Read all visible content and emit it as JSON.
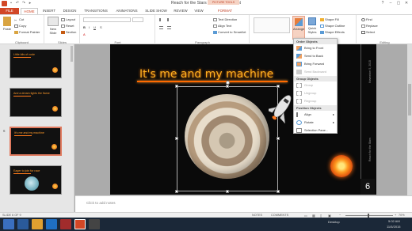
{
  "window": {
    "title": "Reach for the Stars EAN - PowerPoint",
    "contextual_tools": "PICTURE TOOLS",
    "user": "Elizabeth Nofs",
    "buttons": [
      "?",
      "–",
      "▢",
      "✕"
    ]
  },
  "tabs": [
    "FILE",
    "HOME",
    "INSERT",
    "DESIGN",
    "TRANSITIONS",
    "ANIMATIONS",
    "SLIDE SHOW",
    "REVIEW",
    "VIEW",
    "FORMAT"
  ],
  "ribbon": {
    "clipboard": {
      "label": "Clipboard",
      "paste": "Paste",
      "cut": "Cut",
      "copy": "Copy",
      "format_painter": "Format Painter"
    },
    "slides": {
      "label": "Slides",
      "new_slide": "New Slide",
      "layout": "Layout",
      "reset": "Reset",
      "section": "Section"
    },
    "font": {
      "label": "Font"
    },
    "paragraph": {
      "label": "Paragraph",
      "text_direction": "Text Direction",
      "align_text": "Align Text",
      "convert_smartart": "Convert to SmartArt"
    },
    "drawing": {
      "label": "Drawing",
      "arrange": "Arrange",
      "quick_styles": "Quick Styles",
      "shape_fill": "Shape Fill",
      "shape_outline": "Shape Outline",
      "shape_effects": "Shape Effects"
    },
    "editing": {
      "label": "Editing",
      "find": "Find",
      "replace": "Replace",
      "select": "Select"
    }
  },
  "arrange_menu": {
    "order_header": "Order Objects",
    "order_items": [
      {
        "label": "Bring to Front",
        "enabled": true
      },
      {
        "label": "Send to Back",
        "enabled": true
      },
      {
        "label": "Bring Forward",
        "enabled": true
      },
      {
        "label": "Send Backward",
        "enabled": false
      }
    ],
    "group_header": "Group Objects",
    "group_items": [
      {
        "label": "Group",
        "enabled": false
      },
      {
        "label": "Ungroup",
        "enabled": false
      },
      {
        "label": "Regroup",
        "enabled": false
      }
    ],
    "position_header": "Position Objects",
    "position_items": [
      {
        "label": "Align",
        "enabled": true
      },
      {
        "label": "Rotate",
        "enabled": true
      },
      {
        "label": "Selection Pane...",
        "enabled": true
      }
    ]
  },
  "thumbnails": [
    {
      "num": "",
      "title": "Little bits of code"
    },
    {
      "num": "",
      "title": "And a dream lights the flame"
    },
    {
      "num": "6",
      "title": "It's me and my machine"
    },
    {
      "num": "",
      "title": "Eager to join for race"
    }
  ],
  "slide": {
    "title": "It's me and my machine",
    "side_text_top": "November 5, 2015",
    "side_text_bottom": "Reach for the Stars",
    "number": "6"
  },
  "notes_placeholder": "Click to add notes",
  "status": {
    "slide_counter": "SLIDE 6 OF 9",
    "notes": "NOTES",
    "comments": "COMMENTS",
    "zoom": "70%"
  },
  "taskbar": {
    "desktop": "Desktop",
    "time": "5:02 AM",
    "date": "11/5/2015"
  },
  "colors": {
    "accent": "#d24726",
    "slide_title": "#ffb020"
  }
}
